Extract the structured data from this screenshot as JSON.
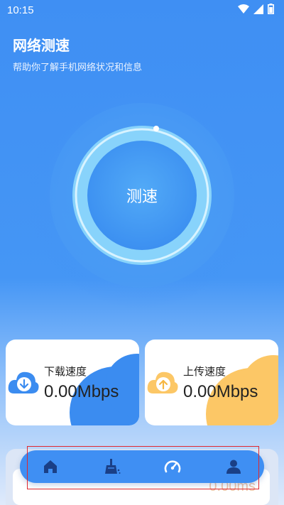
{
  "status_bar": {
    "time": "10:15"
  },
  "header": {
    "title": "网络测速",
    "subtitle": "帮助你了解手机网络状况和信息"
  },
  "speed_button": {
    "label": "测速"
  },
  "cards": {
    "download": {
      "label": "下载速度",
      "value": "0.00Mbps",
      "icon": "download-arrow-icon",
      "accent": "#3b8cf0"
    },
    "upload": {
      "label": "上传速度",
      "value": "0.00Mbps",
      "icon": "upload-arrow-icon",
      "accent": "#fcc766"
    }
  },
  "partial_card": {
    "value": "0.00ms"
  },
  "nav": {
    "items": [
      {
        "icon": "home-icon"
      },
      {
        "icon": "broom-clean-icon"
      },
      {
        "icon": "speedometer-icon"
      },
      {
        "icon": "person-icon"
      }
    ]
  },
  "colors": {
    "primary": "#3f8ff3",
    "highlight": "#e0282f"
  }
}
